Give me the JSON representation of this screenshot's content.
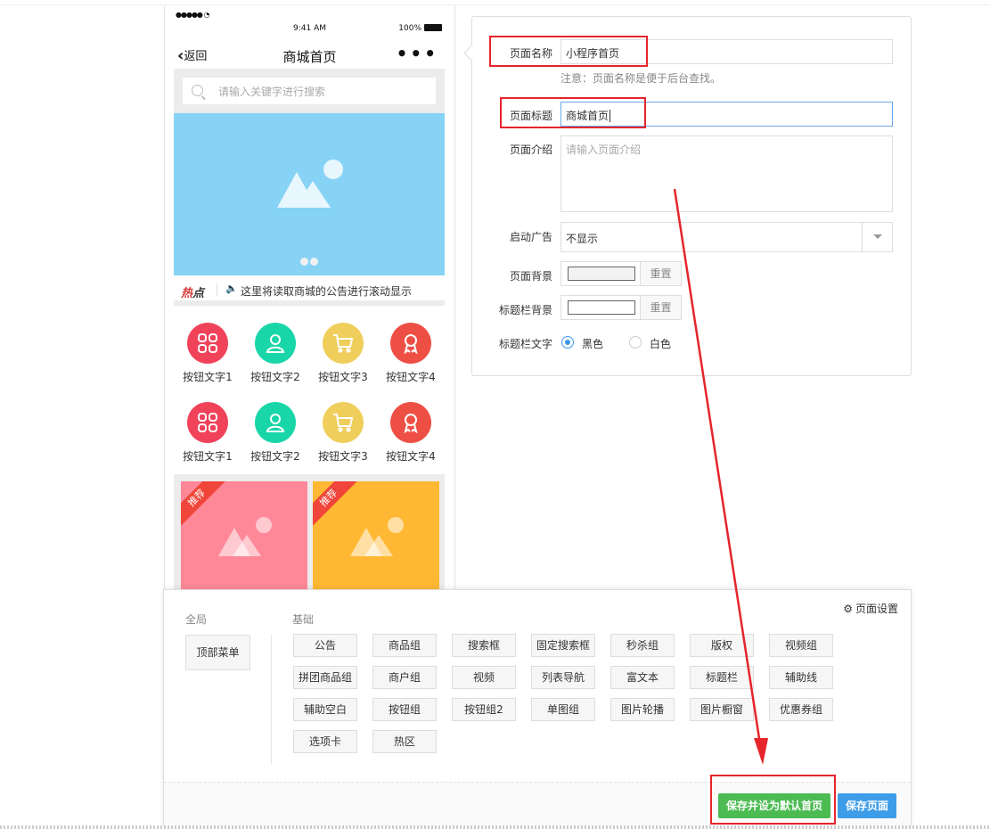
{
  "phone": {
    "status": {
      "signal": "●●●●● ",
      "time": "9:41 AM",
      "battery": "100%"
    },
    "nav": {
      "back_label": "返回",
      "title": "商城首页",
      "more": "•••"
    },
    "search": {
      "placeholder": "请输入关键字进行搜索"
    },
    "notice": {
      "hot_red": "热",
      "hot_dark": "点",
      "text": "这里将读取商城的公告进行滚动显示"
    },
    "buttons": [
      {
        "label": "按钮文字1",
        "color": "#f0435a",
        "icon": "grid-icon"
      },
      {
        "label": "按钮文字2",
        "color": "#19d6a8",
        "icon": "user-icon"
      },
      {
        "label": "按钮文字3",
        "color": "#efce5b",
        "icon": "cart-icon"
      },
      {
        "label": "按钮文字4",
        "color": "#ee4f45",
        "icon": "award-icon"
      },
      {
        "label": "按钮文字1",
        "color": "#f0435a",
        "icon": "grid-icon"
      },
      {
        "label": "按钮文字2",
        "color": "#19d6a8",
        "icon": "user-icon"
      },
      {
        "label": "按钮文字3",
        "color": "#efce5b",
        "icon": "cart-icon"
      },
      {
        "label": "按钮文字4",
        "color": "#ee4f45",
        "icon": "award-icon"
      }
    ],
    "goods": [
      {
        "tag": "推荐",
        "color": "#fe8898"
      },
      {
        "tag": "推荐",
        "color": "#ffb833"
      }
    ]
  },
  "form": {
    "name_label": "页面名称",
    "name_value": "小程序首页",
    "name_note": "注意：页面名称是便于后台查找。",
    "title_label": "页面标题",
    "title_value": "商城首页",
    "intro_label": "页面介绍",
    "intro_placeholder": "请输入页面介绍",
    "ad_label": "启动广告",
    "ad_value": "不显示",
    "bg_label": "页面背景",
    "bg_color": "#f2f2f2",
    "titlebar_bg_label": "标题栏背景",
    "titlebar_bg_color": "#ffffff",
    "reset_label": "重置",
    "titlebar_text_label": "标题栏文字",
    "titlebar_text_options": [
      "黑色",
      "白色"
    ],
    "titlebar_text_selected": "黑色"
  },
  "components": {
    "global_title": "全局",
    "global_items": [
      "顶部菜单"
    ],
    "basic_title": "基础",
    "basic_items": [
      "公告",
      "商品组",
      "搜索框",
      "固定搜索框",
      "秒杀组",
      "版权",
      "视频组",
      "拼团商品组",
      "商户组",
      "视频",
      "列表导航",
      "富文本",
      "标题栏",
      "辅助线",
      "辅助空白",
      "按钮组",
      "按钮组2",
      "单图组",
      "图片轮播",
      "图片橱窗",
      "优惠券组",
      "选项卡",
      "热区"
    ],
    "settings_label": "页面设置",
    "save_default_label": "保存并设为默认首页",
    "save_page_label": "保存页面"
  },
  "colors": {
    "accent": "#3e9de8",
    "success": "#4cbb52",
    "annotation": "#e5252b"
  }
}
